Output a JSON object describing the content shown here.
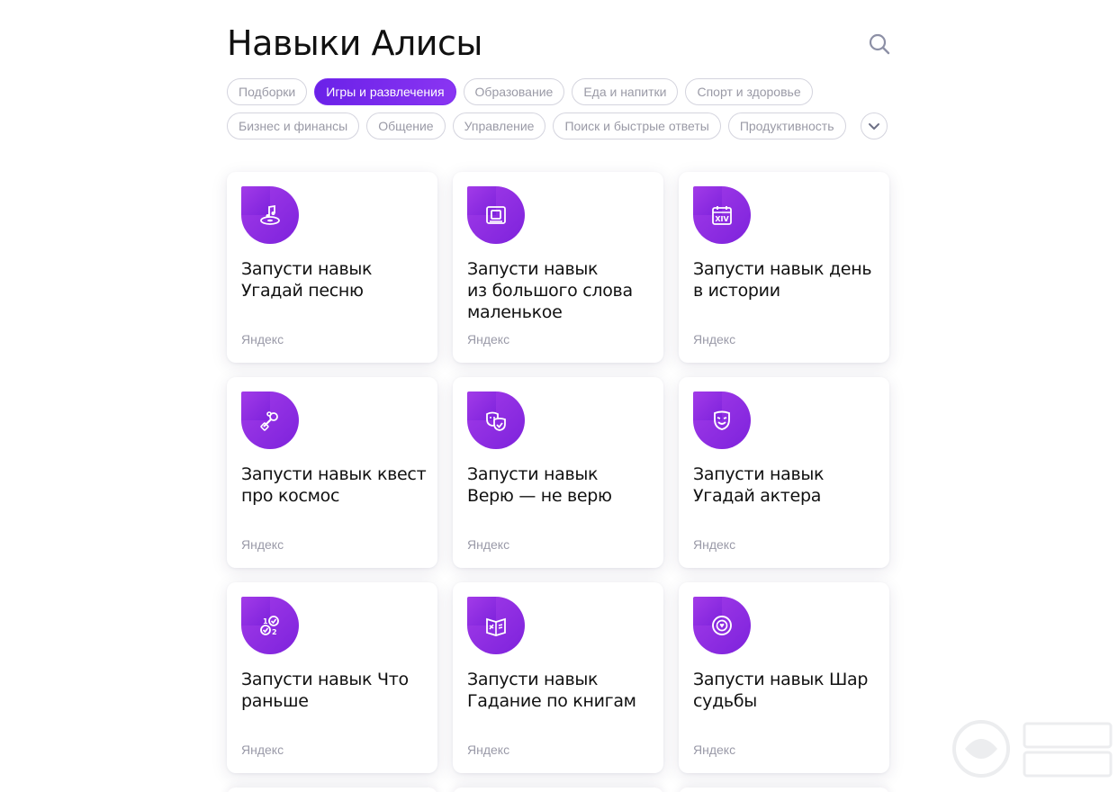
{
  "page": {
    "title": "Навыки Алисы"
  },
  "icons": {
    "search": "search-icon",
    "expand": "chevron-down-icon"
  },
  "colors": {
    "accent": "#7a2df0",
    "icon_bg": "#8b2be0",
    "chip_border": "#d4d4de",
    "chip_text": "#9a9aa6"
  },
  "categories": {
    "row1": [
      {
        "label": "Подборки",
        "active": false
      },
      {
        "label": "Игры и развлечения",
        "active": true
      },
      {
        "label": "Образование",
        "active": false
      },
      {
        "label": "Еда и напитки",
        "active": false
      },
      {
        "label": "Спорт и здоровье",
        "active": false
      }
    ],
    "row2": [
      {
        "label": "Бизнес и финансы",
        "active": false
      },
      {
        "label": "Общение",
        "active": false
      },
      {
        "label": "Управление",
        "active": false
      },
      {
        "label": "Поиск и быстрые ответы",
        "active": false
      },
      {
        "label": "Продуктивность",
        "active": false
      }
    ]
  },
  "skills": [
    {
      "title": "Запусти навык Угадай песню",
      "author": "Яндекс",
      "icon": "music-note-icon"
    },
    {
      "title": "Запусти навык из большого слова маленькое",
      "author": "Яндекс",
      "icon": "word-tile-icon"
    },
    {
      "title": "Запусти навык день в истории",
      "author": "Яндекс",
      "icon": "calendar-icon"
    },
    {
      "title": "Запусти навык квест про космос",
      "author": "Яндекс",
      "icon": "rocket-icon"
    },
    {
      "title": "Запусти навык Верю — не верю",
      "author": "Яндекс",
      "icon": "theater-masks-icon"
    },
    {
      "title": "Запусти навык Угадай актера",
      "author": "Яндекс",
      "icon": "mask-icon"
    },
    {
      "title": "Запусти навык Что раньше",
      "author": "Яндекс",
      "icon": "order-check-icon"
    },
    {
      "title": "Запусти навык Гадание по книгам",
      "author": "Яндекс",
      "icon": "open-book-icon"
    },
    {
      "title": "Запусти навык Шар судьбы",
      "author": "Яндекс",
      "icon": "magic-ball-icon"
    }
  ]
}
